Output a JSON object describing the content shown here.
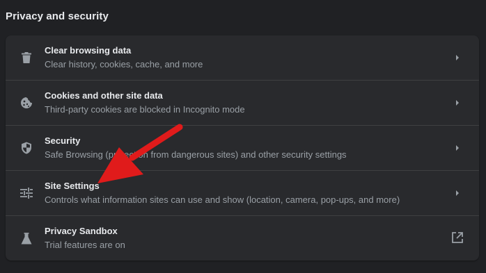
{
  "section": {
    "title": "Privacy and security"
  },
  "rows": [
    {
      "title": "Clear browsing data",
      "subtitle": "Clear history, cookies, cache, and more",
      "icon": "trash-icon",
      "action_icon": "chevron-right-icon"
    },
    {
      "title": "Cookies and other site data",
      "subtitle": "Third-party cookies are blocked in Incognito mode",
      "icon": "cookie-icon",
      "action_icon": "chevron-right-icon"
    },
    {
      "title": "Security",
      "subtitle": "Safe Browsing (protection from dangerous sites) and other security settings",
      "icon": "shield-icon",
      "action_icon": "chevron-right-icon"
    },
    {
      "title": "Site Settings",
      "subtitle": "Controls what information sites can use and show (location, camera, pop-ups, and more)",
      "icon": "tune-sliders-icon",
      "action_icon": "chevron-right-icon"
    },
    {
      "title": "Privacy Sandbox",
      "subtitle": "Trial features are on",
      "icon": "flask-icon",
      "action_icon": "open-in-new-icon"
    }
  ],
  "colors": {
    "background": "#202124",
    "card": "#292a2d",
    "title_text": "#e8eaed",
    "secondary_text": "#9aa0a6",
    "icon": "#9aa0a6",
    "annotation_arrow": "#e01b1b"
  }
}
